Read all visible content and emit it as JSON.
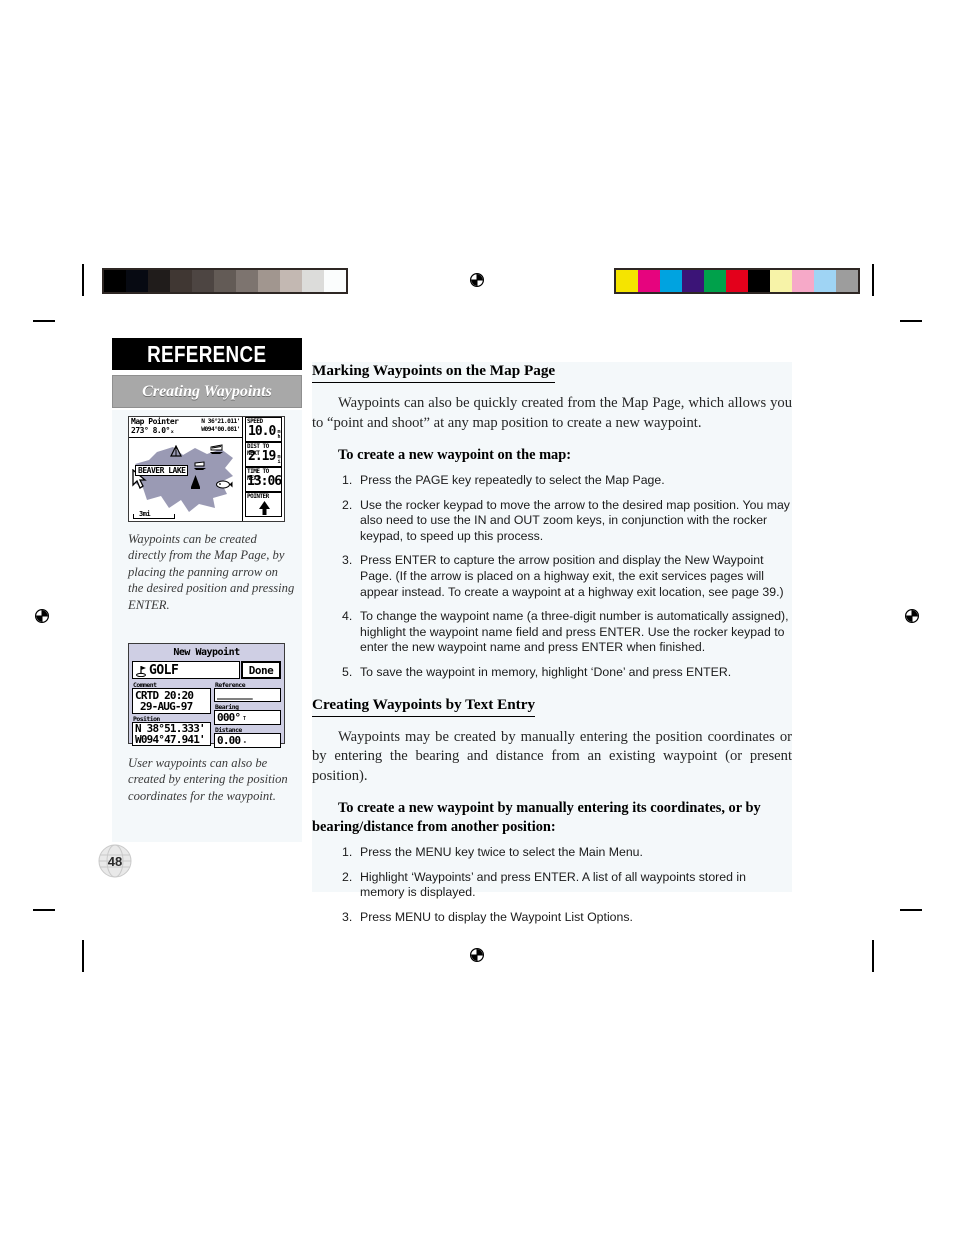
{
  "document": {
    "page_number": "48",
    "reference_banner": "REFERENCE",
    "section_banner": "Creating Waypoints"
  },
  "print_marks": {
    "grayscale_swatches": [
      "#000000",
      "#070a12",
      "#201c1b",
      "#403733",
      "#4d4542",
      "#635b56",
      "#7d746f",
      "#a1968f",
      "#c3b8b2",
      "#dcdcda",
      "#fbfdfd"
    ],
    "color_swatches": [
      "#f5e400",
      "#e6047e",
      "#00a3e0",
      "#3b1477",
      "#00a14b",
      "#e3001b",
      "#000000",
      "#f7f3a8",
      "#f6a9c8",
      "#9fd4f4",
      "#9d9d9d"
    ],
    "registration_icon": "registration-target-icon"
  },
  "sidebar": {
    "map_screenshot": {
      "name": "map-pointer-screenshot",
      "header_label": "Map Pointer",
      "header_bearing": "273°  8.0°ₓ",
      "header_lat": "N 36°21.011'",
      "header_lon": "W094°00.081'",
      "lake_label": "BEAVER LAKE",
      "scale": "3mi",
      "fields": [
        {
          "label": "SPEED",
          "value": "10.0",
          "unit_top": "m",
          "unit_bottom": "h"
        },
        {
          "label": "DIST TO NEXT",
          "value": "2.19",
          "unit_top": "m",
          "unit_bottom": "i"
        },
        {
          "label": "TIME TO NEXT",
          "value": "13:06",
          "unit_top": "",
          "unit_bottom": ""
        },
        {
          "label": "POINTER",
          "value": "",
          "unit_top": "",
          "unit_bottom": ""
        }
      ]
    },
    "map_caption": "Waypoints can be created directly from the Map Page, by placing the panning arrow on the desired position and pressing ENTER.",
    "waypoint_screenshot": {
      "name": "new-waypoint-screenshot",
      "title": "New Waypoint",
      "waypoint_name": "GOLF",
      "done_button": "Done",
      "comment_label": "Comment",
      "comment_line1": "CRTD 20:20",
      "comment_line2": "29-AUG-97",
      "position_label": "Position",
      "position_lat": "N 38°51.333'",
      "position_lon": "W094°47.941'",
      "reference_label": "Reference",
      "reference_value": "______",
      "bearing_label": "Bearing",
      "bearing_value": "000°",
      "bearing_unit": "T",
      "distance_label": "Distance",
      "distance_value": "0.00",
      "distance_unit": "ₓ"
    },
    "waypoint_caption": "User waypoints can also be created by entering the position coordinates for the waypoint."
  },
  "main": {
    "section1": {
      "heading": "Marking Waypoints on the Map Page",
      "paragraph": "Waypoints can also be quickly created from the Map Page, which allows you to “point and shoot” at any map position to create a new waypoint.",
      "procedure_heading": "To create a new waypoint on the map:",
      "steps": [
        {
          "num": "1.",
          "text": "Press the PAGE key repeatedly to select the Map Page."
        },
        {
          "num": "2.",
          "text": "Use the rocker keypad to move the arrow to the desired map position. You may also need to use the IN and OUT zoom keys, in conjunction with the rocker keypad, to speed up this process."
        },
        {
          "num": "3.",
          "text": "Press ENTER to capture the arrow position and display the New Waypoint Page. (If the arrow is placed on a highway exit, the exit services pages will appear instead. To create a waypoint at a highway exit location, see page 39.)"
        },
        {
          "num": "4.",
          "text": "To change the waypoint name (a three-digit number is automatically assigned), highlight the waypoint name field and press ENTER. Use the rocker keypad to enter the new waypoint name and press ENTER when finished."
        },
        {
          "num": "5.",
          "text": "To save the waypoint in memory, highlight ‘Done’ and press ENTER."
        }
      ]
    },
    "section2": {
      "heading": "Creating Waypoints by Text Entry",
      "paragraph": "Waypoints may be created by manually entering the position coordinates or by entering the bearing and distance from an existing waypoint (or present position).",
      "procedure_heading_line1": "To create a new waypoint by manually entering its coordinates, or by",
      "procedure_heading_line2": "bearing/distance from another position:",
      "steps": [
        {
          "num": "1.",
          "text": "Press the MENU key twice to select the Main Menu."
        },
        {
          "num": "2.",
          "text": "Highlight ‘Waypoints’ and press ENTER. A list of all waypoints stored in memory is displayed."
        },
        {
          "num": "3.",
          "text": "Press MENU to display the Waypoint List Options."
        }
      ]
    }
  }
}
